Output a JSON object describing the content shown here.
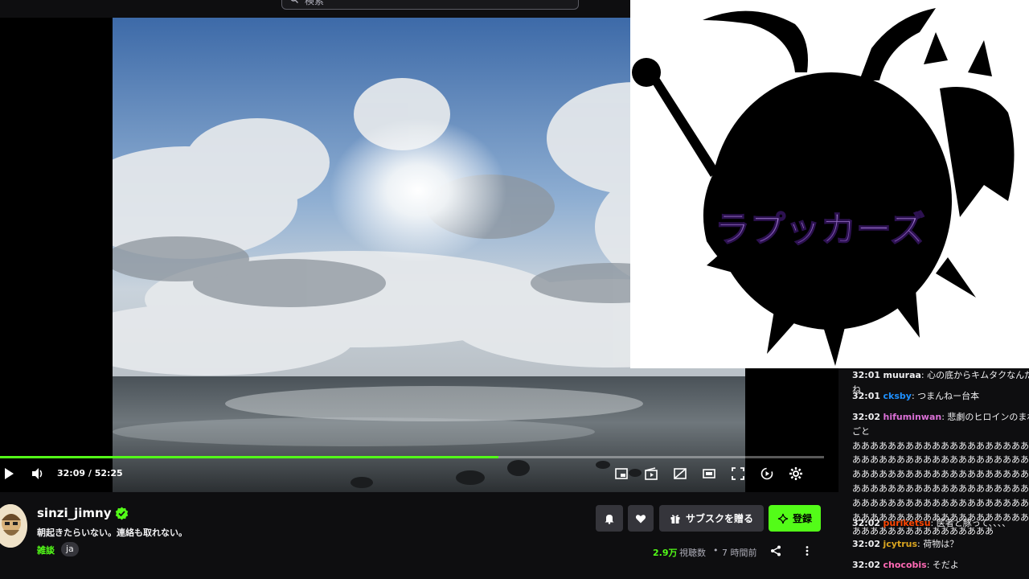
{
  "search": {
    "placeholder": "検索"
  },
  "player": {
    "time": "32:09 / 52:25",
    "progress": 0.605
  },
  "overlay": {
    "logo_text": "ラプッカーズ"
  },
  "stream": {
    "channel": "sinzi_jimny",
    "title": "朝起きたらいない。連絡も取れない。",
    "category": "雑談",
    "language": "ja",
    "viewers": "2.9万",
    "viewers_label": "視聴数",
    "separator": "•",
    "started": "7 時間前"
  },
  "buttons": {
    "gift_sub": "サブスクを贈る",
    "subscribe": "登録"
  },
  "chat": {
    "messages": [
      {
        "time": "32:01",
        "user": "muuraa",
        "color": "#efeff1",
        "text": "心の底からキムタクなんだね"
      },
      {
        "time": "32:01",
        "user": "cksby",
        "color": "#1e90ff",
        "text": "つまんねー台本"
      },
      {
        "time": "32:02",
        "user": "hifuminwan",
        "color": "#da70d6",
        "text": "悲劇のヒロインのまねごと\nああああああああああああああああああああ\nああああああああああああああああああああ\nああああああああああああああああああああ\nああああああああああああああああああああ\nああああああああああああああああああああ\nああああああああああああああああああああ\nああああああああああああああああ"
      },
      {
        "time": "32:02",
        "user": "puriketsu",
        "color": "#ff4500",
        "text": "医者と豚って、、、、"
      },
      {
        "time": "32:02",
        "user": "jcytrus",
        "color": "#daa520",
        "text": "荷物は？"
      },
      {
        "time": "32:02",
        "user": "chocobis",
        "color": "#ff69b4",
        "text": "そだよ"
      }
    ]
  }
}
